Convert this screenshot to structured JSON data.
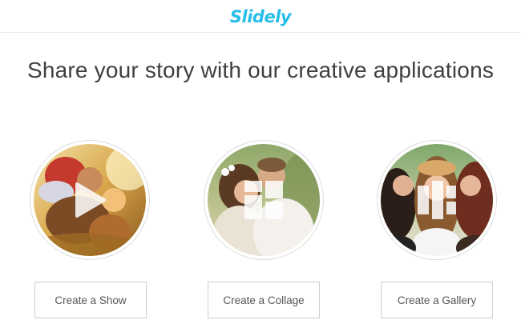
{
  "header": {
    "logo_text": "Slidely"
  },
  "headline": "Share your story with our creative applications",
  "brand_color": "#27bde9",
  "apps": [
    {
      "icon": "play-icon",
      "button_label": "Create a Show"
    },
    {
      "icon": "collage-icon",
      "button_label": "Create a Collage"
    },
    {
      "icon": "gallery-icon",
      "button_label": "Create a Gallery"
    }
  ]
}
